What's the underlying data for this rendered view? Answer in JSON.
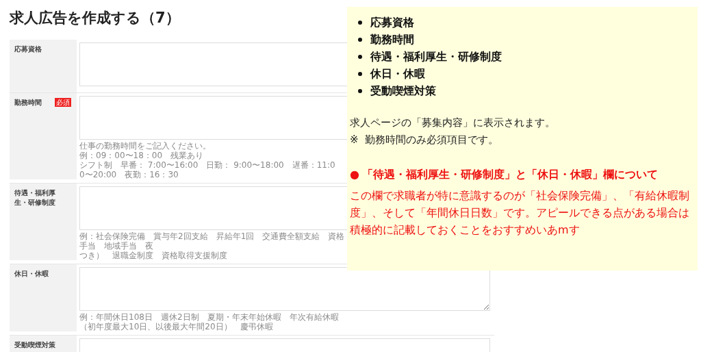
{
  "title": "求人広告を作成する（7）",
  "form": {
    "rows": [
      {
        "label": "応募資格",
        "hint": []
      },
      {
        "label": "勤務時間",
        "badge": "必須",
        "hint": [
          "仕事の勤務時間をご記入ください。",
          "例：09：00〜18：00　残業あり",
          "シフト制　早番： 7:00〜16:00　日勤： 9:00〜18:00　遅番：11:00〜20:00　夜勤：16：30"
        ]
      },
      {
        "label": "待遇・福利厚生・研修制度",
        "hint": [
          "例：社会保険完備　賞与年2回支給　昇給年1回　交通費全額支給　資格手当　地域手当　夜",
          "つき）　退職金制度　資格取得支援制度"
        ]
      },
      {
        "label": "休日・休暇",
        "hint": [
          "例：年間休日108日　週休2日制　夏期・年末年始休暇　年次有給休暇（初年度最大10日、以後最大年間20日）　慶弔休暇"
        ]
      },
      {
        "label": "受動喫煙対策",
        "hint": []
      }
    ]
  },
  "note": {
    "bullets": [
      "応募資格",
      "勤務時間",
      "待遇・福利厚生・研修制度",
      "休日・休暇",
      "受動喫煙対策"
    ],
    "lines": [
      "求人ページの「募集内容」に表示されます。",
      "※  勤務時間のみ必須項目です。"
    ],
    "heading_marker": "●",
    "heading": "「待遇・福利厚生・研修制度」と「休日・休暇」欄について",
    "body": "この欄で求職者が特に意識するのが「社会保険完備」、「有給休暇制度」、そして「年間休日日数」です。アピールできる点がある場合は積極的に記載しておくことをおすすめいあmす"
  }
}
